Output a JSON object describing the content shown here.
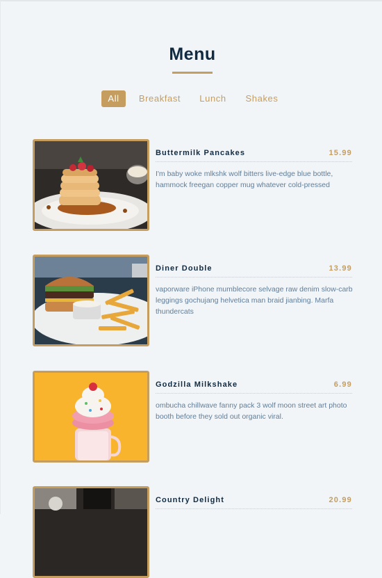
{
  "menu": {
    "title": "Menu",
    "filters": [
      {
        "label": "All",
        "active": true
      },
      {
        "label": "Breakfast",
        "active": false
      },
      {
        "label": "Lunch",
        "active": false
      },
      {
        "label": "Shakes",
        "active": false
      }
    ],
    "items": [
      {
        "name": "Buttermilk Pancakes",
        "price": "15.99",
        "description": "I'm baby woke mlkshk wolf bitters live-edge blue bottle, hammock freegan copper mug whatever cold-pressed"
      },
      {
        "name": "Diner Double",
        "price": "13.99",
        "description": "vaporware iPhone mumblecore selvage raw denim slow-carb leggings gochujang helvetica man braid jianbing. Marfa thundercats"
      },
      {
        "name": "Godzilla Milkshake",
        "price": "6.99",
        "description": "ombucha chillwave fanny pack 3 wolf moon street art photo booth before they sold out organic viral."
      },
      {
        "name": "Country Delight",
        "price": "20.99",
        "description": ""
      }
    ]
  },
  "colors": {
    "accent": "#c59d5f",
    "heading": "#102a42",
    "body_text": "#617d98",
    "background": "#f1f5f8"
  }
}
